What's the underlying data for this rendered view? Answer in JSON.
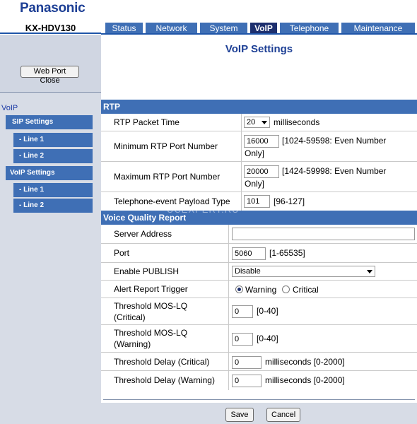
{
  "header": {
    "brand": "Panasonic",
    "model": "KX-HDV130",
    "tabs": [
      "Status",
      "Network",
      "System",
      "VoIP",
      "Telephone",
      "Maintenance"
    ],
    "active_tab": "VoIP"
  },
  "sidebar": {
    "web_port_close": "Web Port Close",
    "section": "VoIP",
    "items": [
      "SIP Settings",
      "- Line 1",
      "- Line 2",
      "VoIP Settings",
      "- Line 1",
      "- Line 2"
    ]
  },
  "page": {
    "title": "VoIP Settings"
  },
  "rtp": {
    "section_title": "RTP",
    "packet_time": {
      "label": "RTP Packet Time",
      "value": "20",
      "unit": "milliseconds"
    },
    "min_port": {
      "label": "Minimum RTP Port Number",
      "value": "16000",
      "hint_1": "[1024-59598: Even Number",
      "hint_2": "Only]"
    },
    "max_port": {
      "label": "Maximum RTP Port Number",
      "value": "20000",
      "hint_1": "[1424-59998: Even Number",
      "hint_2": "Only]"
    },
    "payload_type": {
      "label": "Telephone-event Payload Type",
      "value": "101",
      "hint": "[96-127]"
    }
  },
  "vqr": {
    "section_title": "Voice Quality Report",
    "server_address": {
      "label": "Server Address",
      "value": ""
    },
    "port": {
      "label": "Port",
      "value": "5060",
      "hint": "[1-65535]"
    },
    "enable_publish": {
      "label": "Enable PUBLISH",
      "value": "Disable"
    },
    "alert_trigger": {
      "label": "Alert Report Trigger",
      "options": [
        "Warning",
        "Critical"
      ],
      "selected": "Warning"
    },
    "mos_critical": {
      "label_1": "Threshold MOS-LQ",
      "label_2": "(Critical)",
      "value": "0",
      "hint": "[0-40]"
    },
    "mos_warning": {
      "label_1": "Threshold MOS-LQ",
      "label_2": "(Warning)",
      "value": "0",
      "hint": "[0-40]"
    },
    "delay_critical": {
      "label": "Threshold Delay (Critical)",
      "value": "0",
      "hint": "milliseconds [0-2000]"
    },
    "delay_warning": {
      "label": "Threshold Delay (Warning)",
      "value": "0",
      "hint": "milliseconds [0-2000]"
    }
  },
  "footer": {
    "save": "Save",
    "cancel": "Cancel"
  },
  "watermark": "UCEXPERT.RU",
  "colors": {
    "brand": "#1d3f95",
    "tab": "#3f6fb5",
    "tab_active": "#1d2f6e",
    "sidebar": "#d7dce6"
  }
}
